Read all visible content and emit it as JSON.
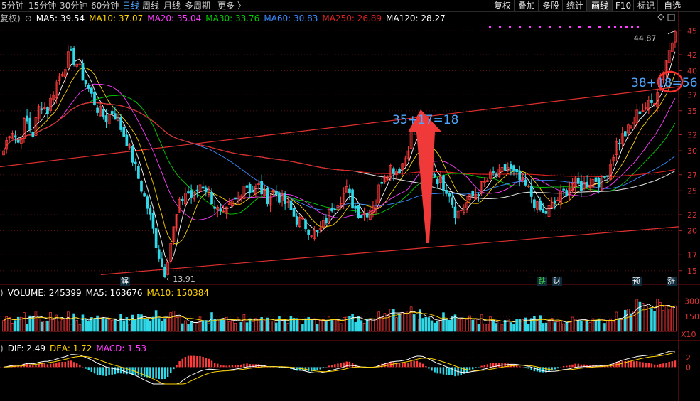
{
  "toolbar": {
    "periods": [
      "5分钟",
      "15分钟",
      "30分钟",
      "60分钟",
      "日线",
      "周线",
      "月线",
      "多周期",
      "更多 〉"
    ],
    "active_period": "日线",
    "tools": [
      "复权",
      "叠加",
      "多股",
      "统计",
      "画线",
      "F10",
      "标记",
      "-自选"
    ],
    "active_tool": "画线"
  },
  "ma_legend": {
    "prefix": "复权)",
    "items": [
      {
        "label": "MA5: 39.54",
        "color": "#ffffff"
      },
      {
        "label": "MA10: 37.07",
        "color": "#ffd400"
      },
      {
        "label": "MA20: 35.04",
        "color": "#ff3cff"
      },
      {
        "label": "MA30: 33.76",
        "color": "#00d000"
      },
      {
        "label": "MA60: 30.83",
        "color": "#3a8bff"
      },
      {
        "label": "MA250: 26.89",
        "color": "#e02020"
      },
      {
        "label": "MA120: 28.27",
        "color": "#ffffff"
      }
    ]
  },
  "volume_legend": {
    "prefix": ")",
    "items": [
      {
        "label": "VOLUME: 245399",
        "color": "#ffffff"
      },
      {
        "label": "MA5: 163676",
        "color": "#ffffff"
      },
      {
        "label": "MA10: 150384",
        "color": "#ffd400"
      }
    ]
  },
  "macd_legend": {
    "prefix": ")",
    "items": [
      {
        "label": "DIF: 2.49",
        "color": "#ffffff"
      },
      {
        "label": "DEA: 1.72",
        "color": "#ffd400"
      },
      {
        "label": "MACD: 1.53",
        "color": "#ff3cff"
      }
    ]
  },
  "annotations": {
    "low_price": "13.91",
    "high_price": "44.87",
    "left_calc": "35+17=18",
    "right_calc": "38+18=56",
    "events": [
      {
        "text": "解",
        "color": "#ffffff"
      },
      {
        "text": "跌",
        "color": "#40d040"
      },
      {
        "text": "财",
        "color": "#ffffff"
      },
      {
        "text": "预",
        "color": "#ffffff"
      },
      {
        "text": "涨",
        "color": "#ffffff"
      }
    ],
    "volume_multiplier": "X10"
  },
  "chart_data": {
    "type": "candlestick",
    "price_axis": {
      "ticks": [
        15,
        17,
        20,
        22,
        25,
        27,
        30,
        32,
        35,
        37,
        40,
        42,
        45
      ],
      "ylim": [
        14,
        46
      ]
    },
    "volume_axis": {
      "ticks": [
        150,
        300
      ],
      "ylim": [
        0,
        340
      ]
    },
    "macd_axis": {
      "ticks": [
        0,
        2
      ],
      "ylim": [
        -3.6,
        3.4
      ]
    },
    "close_path": [
      30,
      33,
      31,
      34,
      32,
      36,
      35,
      38,
      40,
      42,
      41,
      39,
      37,
      35,
      34,
      35,
      33,
      31,
      28,
      25,
      22,
      18,
      14.5,
      19,
      23,
      25,
      24,
      26,
      25,
      23,
      21.5,
      23,
      24,
      26,
      25,
      25.5,
      24,
      25,
      24,
      23,
      21.5,
      21,
      20,
      19.5,
      21,
      23,
      24,
      25,
      23,
      22,
      22.5,
      24,
      27,
      28,
      27.5,
      29,
      33,
      32,
      28,
      27,
      26,
      25,
      22,
      23,
      24,
      25,
      26,
      27,
      27,
      28,
      27,
      26,
      25,
      23,
      22,
      23,
      24,
      25,
      26,
      25.5,
      26,
      26.5,
      26,
      28,
      31,
      32,
      33,
      35,
      35.5,
      36,
      39,
      42,
      44.87
    ],
    "trend_lines": [
      {
        "from": [
          0,
          28.0
        ],
        "to": [
          1,
          38.0
        ]
      },
      {
        "from": [
          0.18,
          14.5
        ],
        "to": [
          1,
          20.5
        ]
      }
    ],
    "trend_calcs": [
      {
        "start": 17,
        "rise": 18
      },
      {
        "start": 38,
        "rise": 18
      }
    ]
  }
}
